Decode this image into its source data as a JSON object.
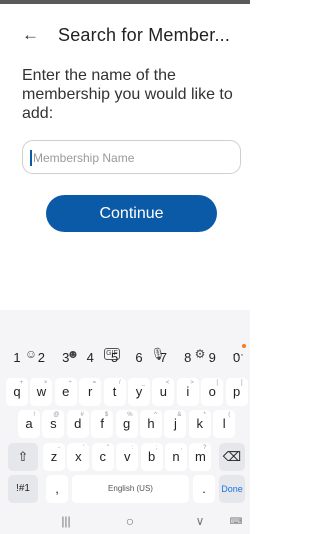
{
  "header": {
    "back_icon": "arrow-left-icon",
    "title": "Search for Member..."
  },
  "main": {
    "prompt": "Enter the name of the membership you would like to add:",
    "input_placeholder": "Membership Name",
    "continue_label": "Continue"
  },
  "keyboard": {
    "toolbar": [
      "☺",
      "☻",
      "GIF",
      "🎙",
      "⚙",
      "···"
    ],
    "numbers": [
      "1",
      "2",
      "3",
      "4",
      "5",
      "6",
      "7",
      "8",
      "9",
      "0"
    ],
    "row_q": [
      "q",
      "w",
      "e",
      "r",
      "t",
      "y",
      "u",
      "i",
      "o",
      "p"
    ],
    "row_q_hints": [
      "+",
      "×",
      "÷",
      "=",
      "/",
      "_",
      "<",
      ">",
      "[",
      "]"
    ],
    "row_a": [
      "a",
      "s",
      "d",
      "f",
      "g",
      "h",
      "j",
      "k",
      "l"
    ],
    "row_a_hints": [
      "!",
      "@",
      "#",
      "$",
      "%",
      "^",
      "&",
      "*",
      "("
    ],
    "row_z": [
      "z",
      "x",
      "c",
      "v",
      "b",
      "n",
      "m"
    ],
    "row_z_hints": [
      "-",
      "'",
      "\"",
      ":",
      ";",
      ",",
      "?"
    ],
    "shift_label": "⇧",
    "backspace_label": "⌫",
    "symbols_label": "!#1",
    "comma_label": ",",
    "space_label": "English (US)",
    "period_label": ".",
    "done_label": "Done"
  },
  "navbar": {
    "recents": "|||",
    "home": "○",
    "back": "∨",
    "keyboard": "⌨"
  },
  "colors": {
    "accent": "#0b5aa7",
    "notification_dot": "#f47b20"
  }
}
